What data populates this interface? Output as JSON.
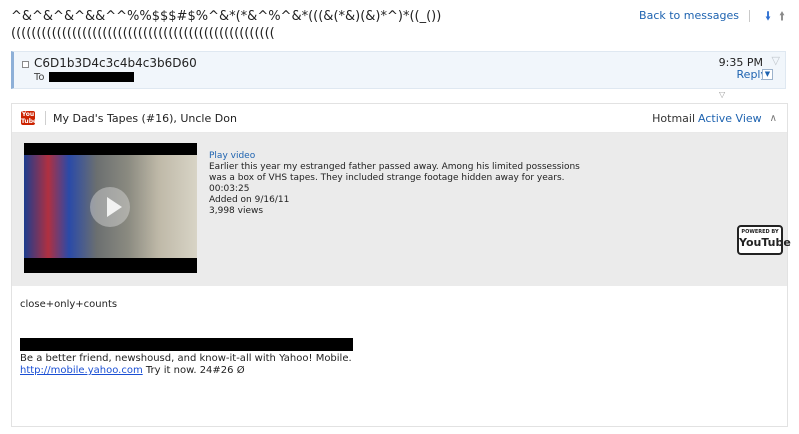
{
  "message": {
    "subject": "^&^&^&^&&^^%%$$$#$%^&*(*&^%^&*(((&(*&)(&)*^)*((_()) ((((((((((((((((((((((((((((((((((((((((((((((((((((",
    "back_label": "Back to messages",
    "sender": "C6D1b3D4c3c4b4c3b6D60",
    "to_label": "To",
    "time": "9:35 PM",
    "reply_label": "Reply"
  },
  "active_view": {
    "title": "My Dad's Tapes (#16), Uncle Don",
    "provider": "Hotmail",
    "view_label": "Active View",
    "play_label": "Play video",
    "description": "Earlier this year my estranged father passed away. Among his limited possessions was a box of VHS tapes. They included strange footage hidden away for years.",
    "duration": "00:03:25",
    "added": "Added on 9/16/11",
    "views": "3,998 views",
    "powered_by": "POWERED BY",
    "youtube": "YouTube"
  },
  "body": {
    "line1": "close+only+counts",
    "line2": "Be a better friend, newshousd, and know-it-all with Yahoo! Mobile.",
    "link": "http://mobile.yahoo.com",
    "line3_rest": " Try it now. 24#26 Ø"
  },
  "colors": {
    "link": "#1e63b0",
    "card_bg": "#ebebeb",
    "header_bg": "#f1f6fb"
  },
  "icons": [
    "down-arrow-icon",
    "up-arrow-icon",
    "checkbox-icon",
    "flag-icon",
    "chevron-down-icon",
    "youtube-icon",
    "collapse-icon",
    "play-icon"
  ]
}
